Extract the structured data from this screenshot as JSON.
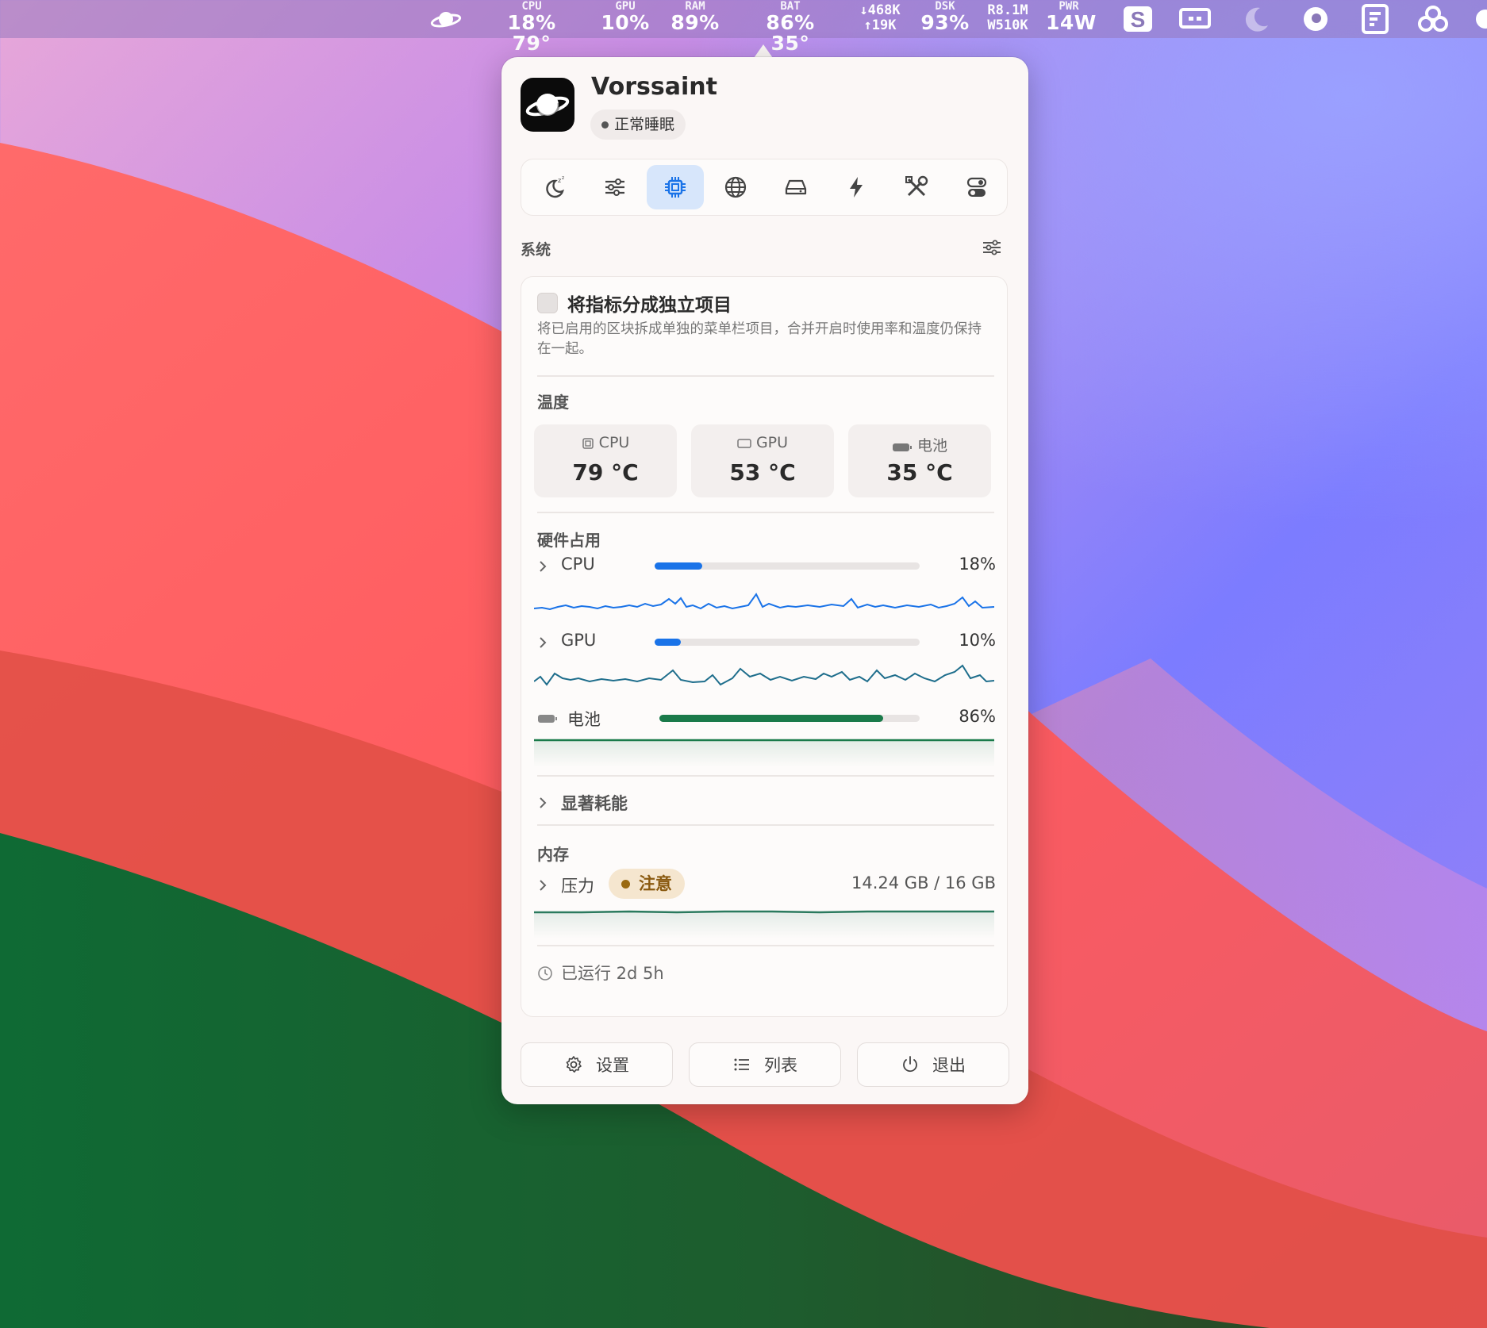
{
  "menubar": {
    "cpu": {
      "label": "CPU",
      "value": "18% 79°"
    },
    "gpu": {
      "label": "GPU",
      "value": "10%"
    },
    "ram": {
      "label": "RAM",
      "value": "89%"
    },
    "bat": {
      "label": "BAT",
      "value": "86% 35°"
    },
    "net": {
      "down": "↓468K",
      "up": "↑19K"
    },
    "dsk": {
      "label": "DSK",
      "value": "93%"
    },
    "rw": {
      "read": "R8.1M",
      "write": "W510K"
    },
    "pwr": {
      "label": "PWR",
      "value": "14W"
    }
  },
  "app": {
    "name": "Vorssaint",
    "status": "正常睡眠"
  },
  "tabs": [
    {
      "icon": "sleep-moon-icon",
      "active": false
    },
    {
      "icon": "sliders-icon",
      "active": false
    },
    {
      "icon": "chip-icon",
      "active": true
    },
    {
      "icon": "globe-icon",
      "active": false
    },
    {
      "icon": "drive-icon",
      "active": false
    },
    {
      "icon": "bolt-icon",
      "active": false
    },
    {
      "icon": "tools-icon",
      "active": false
    },
    {
      "icon": "toggles-icon",
      "active": false
    }
  ],
  "section": {
    "title": "系统"
  },
  "option": {
    "title": "将指标分成独立项目",
    "description": "将已启用的区块拆成单独的菜单栏项目，合并开启时使用率和温度仍保持在一起。",
    "checked": false
  },
  "temperature": {
    "title": "温度",
    "items": [
      {
        "label": "CPU",
        "value": "79 °C"
      },
      {
        "label": "GPU",
        "value": "53 °C"
      },
      {
        "label": "电池",
        "value": "35 °C"
      }
    ]
  },
  "hardware": {
    "title": "硬件占用",
    "cpu": {
      "label": "CPU",
      "percent": 18,
      "text": "18%"
    },
    "gpu": {
      "label": "GPU",
      "percent": 10,
      "text": "10%"
    },
    "battery": {
      "label": "电池",
      "percent": 86,
      "text": "86%"
    }
  },
  "energy": {
    "label": "显著耗能"
  },
  "memory": {
    "title": "内存",
    "pressure_label": "压力",
    "pressure_status": "注意",
    "usage": "14.24 GB / 16 GB"
  },
  "uptime": "已运行 2d 5h",
  "footer": {
    "settings": "设置",
    "list": "列表",
    "quit": "退出"
  },
  "colors": {
    "accent": "#1a73e8",
    "battery": "#1a7a4a",
    "spark": "#1f6e8c",
    "memory_line": "#2b7a5e",
    "warning": "#9a6a12"
  }
}
